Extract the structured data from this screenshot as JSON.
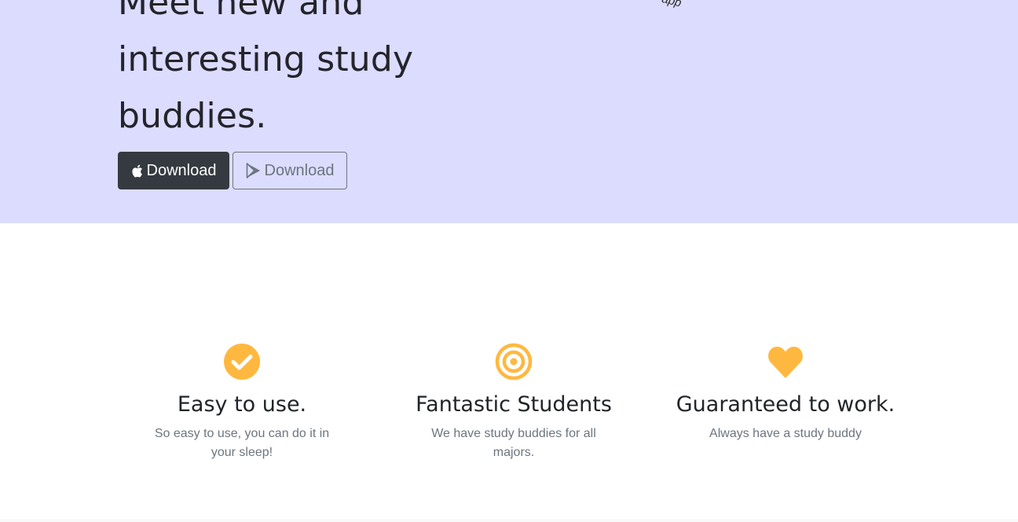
{
  "hero": {
    "title_lines": [
      "Meet new and",
      "interesting study",
      "buddies."
    ],
    "image_alt": "app",
    "buttons": [
      {
        "label": "Download",
        "icon": "apple-icon",
        "style": "dark"
      },
      {
        "label": "Download",
        "icon": "google-play-icon",
        "style": "outline"
      }
    ]
  },
  "features": [
    {
      "icon": "check-circle-icon",
      "title": "Easy to use.",
      "text": "So easy to use, you can do it in your sleep!"
    },
    {
      "icon": "bullseye-icon",
      "title": "Fantastic Students",
      "text": "We have study buddies for all majors."
    },
    {
      "icon": "heart-icon",
      "title": "Guaranteed to work.",
      "text": "Always have a study buddy"
    }
  ],
  "colors": {
    "hero_bg": "#dcdcff",
    "accent": "#ffb83f",
    "dark_button": "#343a40",
    "muted_text": "#6c757d"
  }
}
